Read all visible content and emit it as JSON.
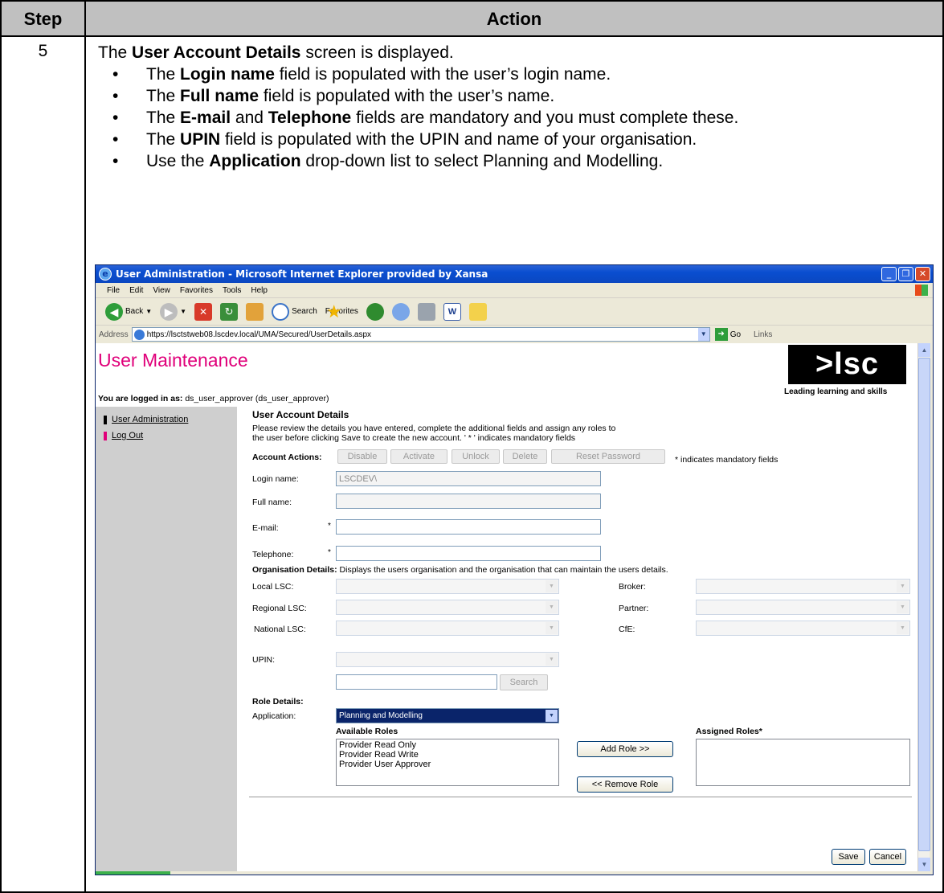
{
  "doc": {
    "header_step": "Step",
    "header_action": "Action",
    "step_number": "5",
    "intro_pre": "The ",
    "intro_bold": "User Account Details",
    "intro_post": " screen is displayed.",
    "bullets": [
      {
        "pre": "The ",
        "bold": "Login name",
        "post": " field is populated with the user’s login name."
      },
      {
        "pre": "The ",
        "bold": "Full name",
        "post": " field is populated with the user’s name."
      },
      {
        "pre": "The ",
        "bold": "E-mail",
        "mid": " and ",
        "bold2": "Telephone",
        "post": " fields are mandatory and you must complete these."
      },
      {
        "pre": "The ",
        "bold": "UPIN",
        "post": " field is populated with the UPIN and name of your organisation."
      },
      {
        "pre": "Use the ",
        "bold": "Application",
        "post": " drop-down list to select Planning and Modelling."
      }
    ]
  },
  "browser": {
    "title": "User Administration - Microsoft Internet Explorer provided by Xansa",
    "menu": [
      "File",
      "Edit",
      "View",
      "Favorites",
      "Tools",
      "Help"
    ],
    "toolbar": {
      "back": "Back",
      "search": "Search",
      "favorites": "Favorites"
    },
    "address_label": "Address",
    "url": "https://lsctstweb08.lscdev.local/UMA/Secured/UserDetails.aspx",
    "go": "Go",
    "links": "Links"
  },
  "page": {
    "title": "User Maintenance",
    "logo": ">lsc",
    "logo_tagline": "Leading learning and skills",
    "logged_in_label": "You are logged in as:",
    "logged_in_user": "ds_user_approver (ds_user_approver)",
    "nav": [
      {
        "label": "User Administration",
        "color": "#000000"
      },
      {
        "label": "Log Out",
        "color": "#e0007a"
      }
    ],
    "section_title": "User Account Details",
    "intro_line1": "Please review the details you have entered, complete the additional fields and assign any roles to",
    "intro_line2": "the user before clicking Save to create the new account.   ' * ' indicates mandatory fields",
    "account_actions_label": "Account Actions:",
    "account_actions": [
      "Disable",
      "Activate",
      "Unlock",
      "Delete",
      "Reset Password"
    ],
    "mandatory_note": "* indicates mandatory fields",
    "fields": {
      "login_label": "Login name:",
      "login_value": "LSCDEV\\",
      "fullname_label": "Full name:",
      "email_label": "E-mail:",
      "telephone_label": "Telephone:",
      "required_marker": "*"
    },
    "org_label": "Organisation Details:",
    "org_desc": " Displays the users organisation and the organisation that can maintain the users details.",
    "org_fields": {
      "local": "Local LSC:",
      "regional": "Regional LSC:",
      "national": "National LSC:",
      "broker": "Broker:",
      "partner": "Partner:",
      "cfe": "CfE:",
      "upin": "UPIN:"
    },
    "search_button": "Search",
    "role_details_label": "Role Details:",
    "application_label": "Application:",
    "application_value": "Planning and Modelling",
    "available_roles_label": "Available Roles",
    "available_roles": [
      "Provider Read Only",
      "Provider Read Write",
      "Provider User Approver"
    ],
    "assigned_roles_label": "Assigned Roles*",
    "add_role": "Add Role >>",
    "remove_role": "<< Remove Role",
    "save": "Save",
    "cancel": "Cancel"
  }
}
